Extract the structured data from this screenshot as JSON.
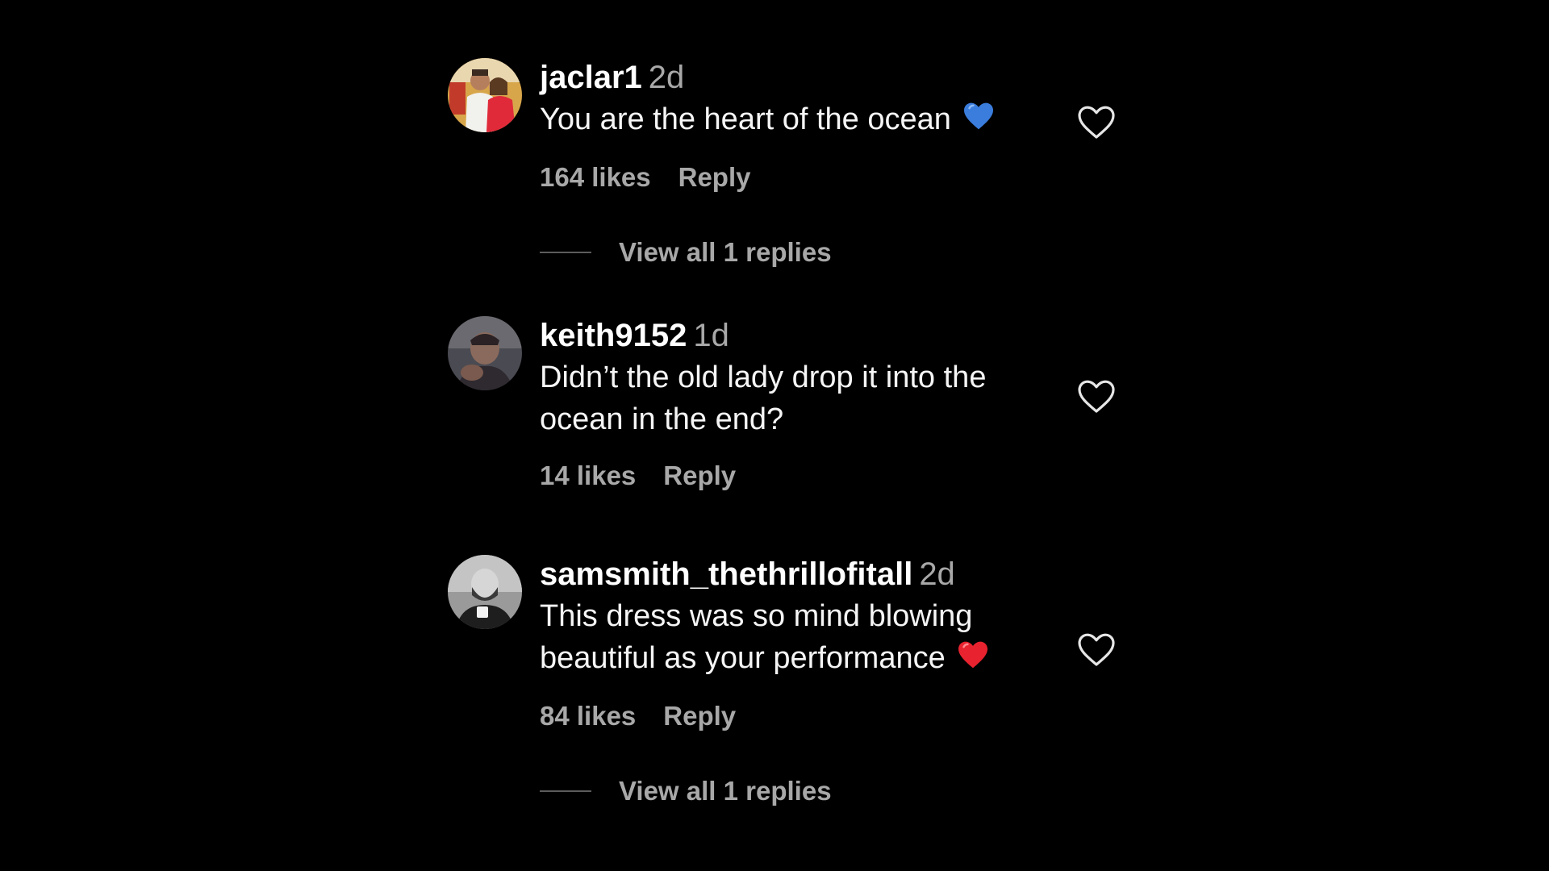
{
  "comments": [
    {
      "username": "jaclar1",
      "time": "2d",
      "text": "You are the heart of the ocean",
      "emoji": "blue-heart",
      "emoji_color": "#3b7ddd",
      "likes": "164 likes",
      "reply_label": "Reply",
      "view_replies": "View all 1 replies"
    },
    {
      "username": "keith9152",
      "time": "1d",
      "text": "Didn’t the old lady drop it into the ocean in the end?",
      "likes": "14 likes",
      "reply_label": "Reply"
    },
    {
      "username": "samsmith_thethrillofitall",
      "time": "2d",
      "text": "This dress was so mind blowing beautiful as your performance",
      "emoji": "red-heart",
      "emoji_color": "#e8232f",
      "likes": "84 likes",
      "reply_label": "Reply",
      "view_replies": "View all 1 replies"
    }
  ],
  "icons": {
    "like": "heart-outline-icon"
  },
  "colors": {
    "background": "#000000",
    "secondary_text": "#a8a8a8",
    "primary_text": "#ffffff"
  }
}
